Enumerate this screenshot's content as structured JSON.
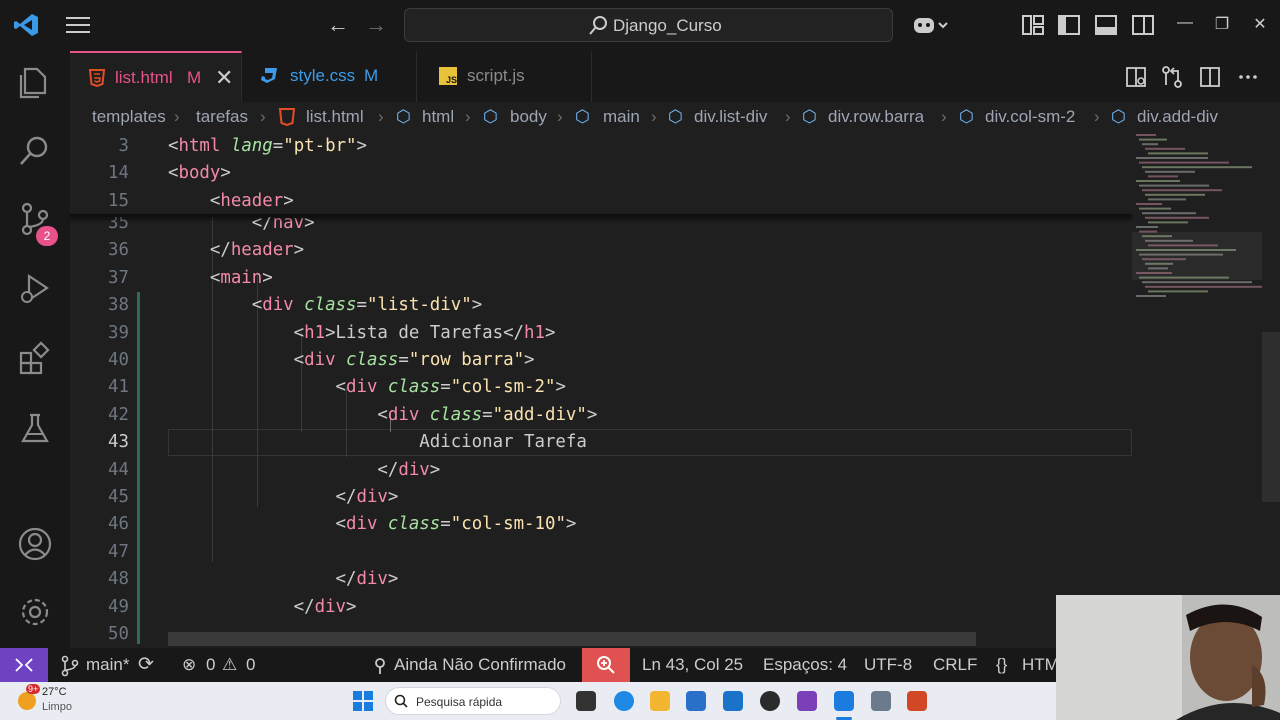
{
  "title_bar": {
    "search_label": "Django_Curso",
    "nav_back": "←",
    "nav_forward": "→",
    "minimize": "—",
    "maximize": "❐",
    "close": "✕"
  },
  "tabs": [
    {
      "label": "list.html",
      "modified": "M",
      "icon": "html-file-icon",
      "active": true
    },
    {
      "label": "style.css",
      "modified": "M",
      "icon": "css-file-icon",
      "active": false
    },
    {
      "label": "script.js",
      "modified": "",
      "icon": "js-file-icon",
      "active": false
    }
  ],
  "breadcrumb": [
    "templates",
    "tarefas",
    "list.html",
    "html",
    "body",
    "main",
    "div.list-div",
    "div.row.barra",
    "div.col-sm-2",
    "div.add-div"
  ],
  "activity_bar": {
    "source_control_badge": "2"
  },
  "editor": {
    "sticky_lines": [
      {
        "num": "3",
        "parts": [
          [
            "pu",
            "<"
          ],
          [
            "tg",
            "html"
          ],
          [
            "pu",
            " "
          ],
          [
            "at",
            "lang"
          ],
          [
            "pu",
            "="
          ],
          [
            "st",
            "\"pt-br\""
          ],
          [
            "pu",
            ">"
          ]
        ]
      },
      {
        "num": "14",
        "parts": [
          [
            "pu",
            "<"
          ],
          [
            "tg",
            "body"
          ],
          [
            "pu",
            ">"
          ]
        ]
      },
      {
        "num": "15",
        "parts": [
          [
            "pu",
            "    <"
          ],
          [
            "tg",
            "header"
          ],
          [
            "pu",
            ">"
          ]
        ]
      }
    ],
    "lines": [
      {
        "num": "35",
        "parts": [
          [
            "pu",
            "        </"
          ],
          [
            "tg",
            "nav"
          ],
          [
            "pu",
            ">"
          ]
        ]
      },
      {
        "num": "36",
        "parts": [
          [
            "pu",
            "    </"
          ],
          [
            "tg",
            "header"
          ],
          [
            "pu",
            ">"
          ]
        ]
      },
      {
        "num": "37",
        "parts": [
          [
            "pu",
            "    <"
          ],
          [
            "tg",
            "main"
          ],
          [
            "pu",
            ">"
          ]
        ]
      },
      {
        "num": "38",
        "parts": [
          [
            "pu",
            "        <"
          ],
          [
            "tg",
            "div"
          ],
          [
            "pu",
            " "
          ],
          [
            "at",
            "class"
          ],
          [
            "pu",
            "="
          ],
          [
            "st",
            "\"list-div\""
          ],
          [
            "pu",
            ">"
          ]
        ]
      },
      {
        "num": "39",
        "parts": [
          [
            "pu",
            "            <"
          ],
          [
            "tg",
            "h1"
          ],
          [
            "pu",
            ">Lista de Tarefas</"
          ],
          [
            "tg",
            "h1"
          ],
          [
            "pu",
            ">"
          ]
        ]
      },
      {
        "num": "40",
        "parts": [
          [
            "pu",
            "            <"
          ],
          [
            "tg",
            "div"
          ],
          [
            "pu",
            " "
          ],
          [
            "at",
            "class"
          ],
          [
            "pu",
            "="
          ],
          [
            "st",
            "\"row barra\""
          ],
          [
            "pu",
            ">"
          ]
        ]
      },
      {
        "num": "41",
        "parts": [
          [
            "pu",
            "                <"
          ],
          [
            "tg",
            "div"
          ],
          [
            "pu",
            " "
          ],
          [
            "at",
            "class"
          ],
          [
            "pu",
            "="
          ],
          [
            "st",
            "\"col-sm-2\""
          ],
          [
            "pu",
            ">"
          ]
        ]
      },
      {
        "num": "42",
        "parts": [
          [
            "pu",
            "                    <"
          ],
          [
            "tg",
            "div"
          ],
          [
            "pu",
            " "
          ],
          [
            "at",
            "class"
          ],
          [
            "pu",
            "="
          ],
          [
            "st",
            "\"add-div\""
          ],
          [
            "pu",
            ">"
          ]
        ]
      },
      {
        "num": "43",
        "parts": [
          [
            "pu",
            "                        Adicionar Tarefa"
          ]
        ]
      },
      {
        "num": "44",
        "parts": [
          [
            "pu",
            "                    </"
          ],
          [
            "tg",
            "div"
          ],
          [
            "pu",
            ">"
          ]
        ]
      },
      {
        "num": "45",
        "parts": [
          [
            "pu",
            "                </"
          ],
          [
            "tg",
            "div"
          ],
          [
            "pu",
            ">"
          ]
        ]
      },
      {
        "num": "46",
        "parts": [
          [
            "pu",
            "                <"
          ],
          [
            "tg",
            "div"
          ],
          [
            "pu",
            " "
          ],
          [
            "at",
            "class"
          ],
          [
            "pu",
            "="
          ],
          [
            "st",
            "\"col-sm-10\""
          ],
          [
            "pu",
            ">"
          ]
        ]
      },
      {
        "num": "47",
        "parts": [
          [
            "pu",
            ""
          ]
        ]
      },
      {
        "num": "48",
        "parts": [
          [
            "pu",
            "                </"
          ],
          [
            "tg",
            "div"
          ],
          [
            "pu",
            ">"
          ]
        ]
      },
      {
        "num": "49",
        "parts": [
          [
            "pu",
            "            </"
          ],
          [
            "tg",
            "div"
          ],
          [
            "pu",
            ">"
          ]
        ]
      },
      {
        "num": "50",
        "parts": [
          [
            "pu",
            ""
          ]
        ]
      }
    ],
    "current_line": "43"
  },
  "status_bar": {
    "branch": "main*",
    "errors": "0",
    "warnings": "0",
    "commit_state": "Ainda Não Confirmado",
    "cursor": "Ln 43, Col 25",
    "indent": "Espaços: 4",
    "encoding": "UTF-8",
    "eol": "CRLF",
    "language": "HTM"
  },
  "taskbar": {
    "weather_temp": "27°C",
    "weather_state": "Limpo",
    "weather_badge": "9+",
    "search_placeholder": "Pesquisa rápida"
  },
  "colors": {
    "accent": "#e8528a",
    "remote": "#6f42c1",
    "tag": "#f38ba8",
    "attr": "#a6e3a1",
    "string": "#f9e2af"
  }
}
